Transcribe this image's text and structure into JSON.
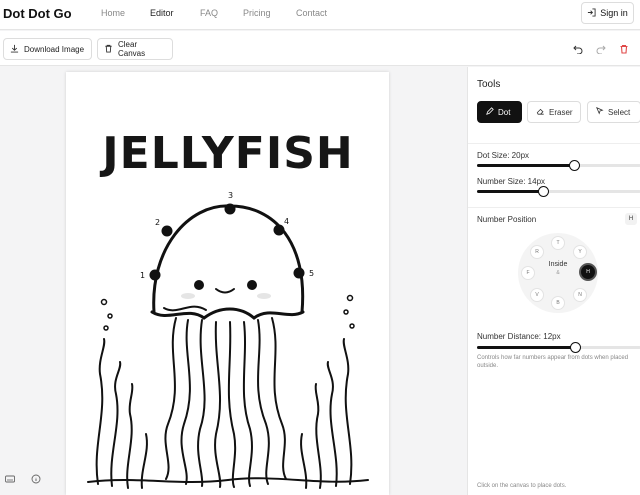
{
  "nav": {
    "brand": "Dot Dot Go",
    "links": [
      "Home",
      "Editor",
      "FAQ",
      "Pricing",
      "Contact"
    ],
    "active": "Editor",
    "signin": "Sign in"
  },
  "toolbar": {
    "download_label": "Download Image",
    "clear_label": "Clear Canvas"
  },
  "canvas": {
    "title": "JELLYFISH",
    "dot_numbers": [
      "1",
      "2",
      "3",
      "4",
      "5"
    ]
  },
  "panel": {
    "title": "Tools",
    "tools": [
      "Dot",
      "Eraser",
      "Select"
    ],
    "active_tool": "Dot",
    "dot_size_label": "Dot Size: 20px",
    "dot_size_value": 20,
    "number_size_label": "Number Size: 14px",
    "number_size_value": 14,
    "number_position_label": "Number Position",
    "position_badge": "H",
    "dial": {
      "center_label": "Inside",
      "center_sub": "&",
      "positions": [
        "T",
        "Y",
        "R",
        "H",
        "N",
        "B",
        "V",
        "F"
      ],
      "selected": "H"
    },
    "number_distance_label": "Number Distance: 12px",
    "number_distance_value": 12,
    "distance_hint": "Controls how far numbers appear from dots when placed outside.",
    "footer_hint": "Click on the canvas to place dots."
  }
}
